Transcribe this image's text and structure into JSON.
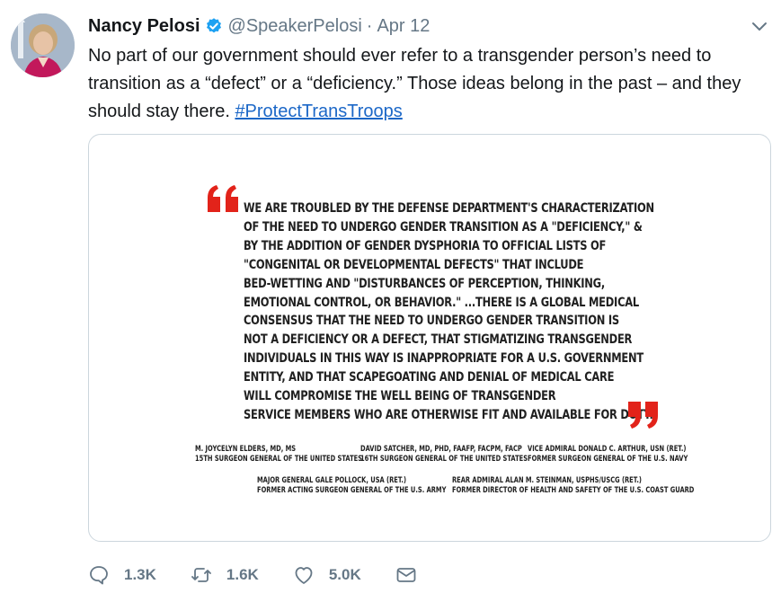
{
  "tweet": {
    "author_name": "Nancy Pelosi",
    "handle": "@SpeakerPelosi",
    "separator": "·",
    "date": "Apr 12",
    "text": "No part of our government should ever refer to a transgender person’s need to transition as a “defect” or a “deficiency.” Those ideas belong in the past – and they should stay there. ",
    "hashtag": "#ProtectTransTroops"
  },
  "image": {
    "quote_lines": [
      "We are troubled by the Defense Department's characterization",
      "of the need to undergo gender transition as a \"deficiency,\" &",
      "by the addition of gender dysphoria to official lists of",
      "\"congenital or developmental defects\" that include",
      "bed-wetting and \"disturbances of perception, thinking,",
      "emotional control, or behavior.\" ...There is a global medical",
      "consensus that the need to undergo gender transition is",
      "not a deficiency or a defect, that stigmatizing transgender",
      "individuals in this way is inappropriate for a U.S. government",
      "entity, and that scapegoating and denial of medical care",
      "will compromise the well being of transgender",
      "service members who are otherwise fit and available for duty."
    ],
    "signatures": [
      {
        "name": "M. Joycelyn Elders, MD, MS",
        "title": "15th Surgeon General of the United States"
      },
      {
        "name": "David Satcher, MD, PhD, FAAFP, FACPM, FACP",
        "title": "16th Surgeon General of the United States"
      },
      {
        "name": "Vice Admiral Donald C. Arthur, USN (Ret.)",
        "title": "Former Surgeon General of the U.S. Navy"
      },
      {
        "name": "Major General Gale Pollock, USA (Ret.)",
        "title": "Former Acting Surgeon General of the U.S. Army"
      },
      {
        "name": "Rear Admiral Alan M. Steinman, USPHS/USCG (Ret.)",
        "title": "Former Director of Health and Safety of the U.S. Coast Guard"
      }
    ]
  },
  "actions": {
    "replies": "1.3K",
    "retweets": "1.6K",
    "likes": "5.0K"
  },
  "colors": {
    "verified": "#1da1f2",
    "quote_marks": "#e2231a",
    "hashtag": "#1b67c7",
    "muted": "#657786"
  }
}
